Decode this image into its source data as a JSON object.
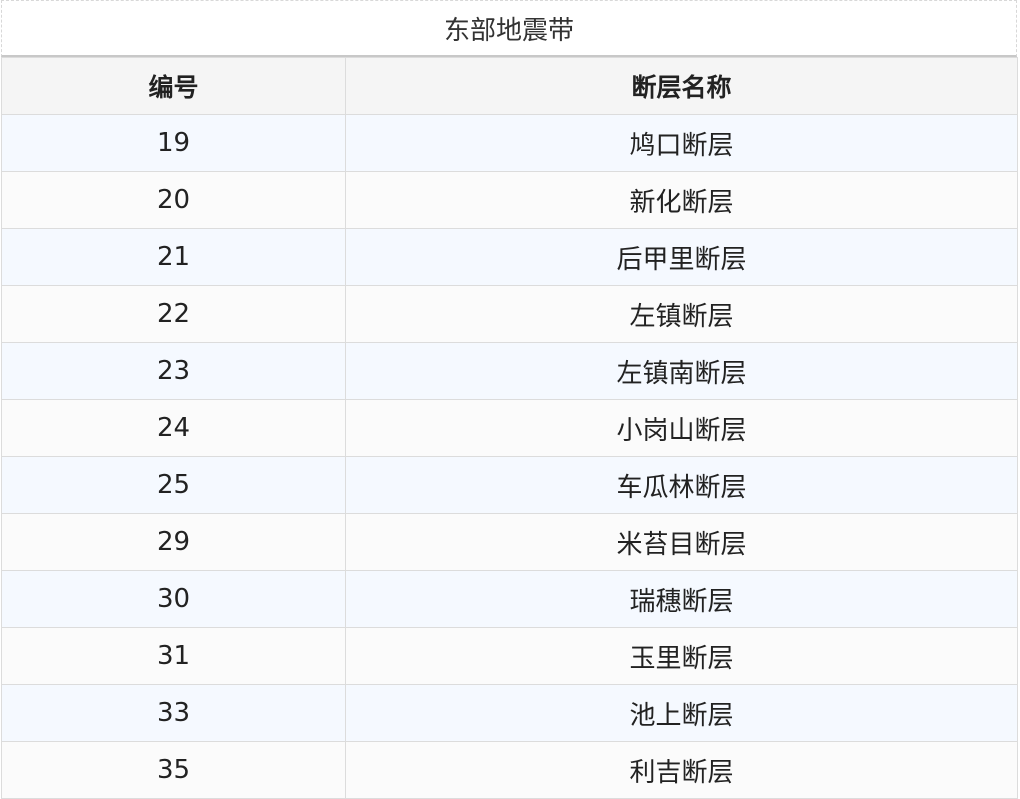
{
  "table": {
    "caption": "东部地震带",
    "headers": [
      "编号",
      "断层名称"
    ],
    "rows": [
      [
        "19",
        "鸠口断层"
      ],
      [
        "20",
        "新化断层"
      ],
      [
        "21",
        "后甲里断层"
      ],
      [
        "22",
        "左镇断层"
      ],
      [
        "23",
        "左镇南断层"
      ],
      [
        "24",
        "小岗山断层"
      ],
      [
        "25",
        "车瓜林断层"
      ],
      [
        "29",
        "米苔目断层"
      ],
      [
        "30",
        "瑞穗断层"
      ],
      [
        "31",
        "玉里断层"
      ],
      [
        "33",
        "池上断层"
      ],
      [
        "35",
        "利吉断层"
      ]
    ]
  }
}
